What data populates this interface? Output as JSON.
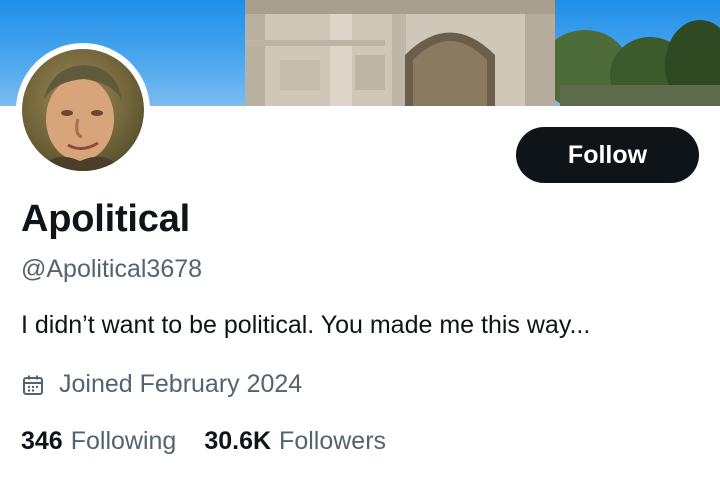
{
  "profile": {
    "display_name": "Apolitical",
    "handle": "@Apolitical3678",
    "bio": "I didn’t want to be political. You made me this way...",
    "joined": "Joined February 2024",
    "follow_label": "Follow"
  },
  "stats": {
    "following_count": "346",
    "following_label": "Following",
    "followers_count": "30.6K",
    "followers_label": "Followers"
  },
  "icons": {
    "joined": "calendar-icon"
  },
  "colors": {
    "primary_text": "#0f1419",
    "secondary_text": "#536471",
    "follow_button": "#0f1419",
    "banner_sky": "#3a9ce9"
  }
}
